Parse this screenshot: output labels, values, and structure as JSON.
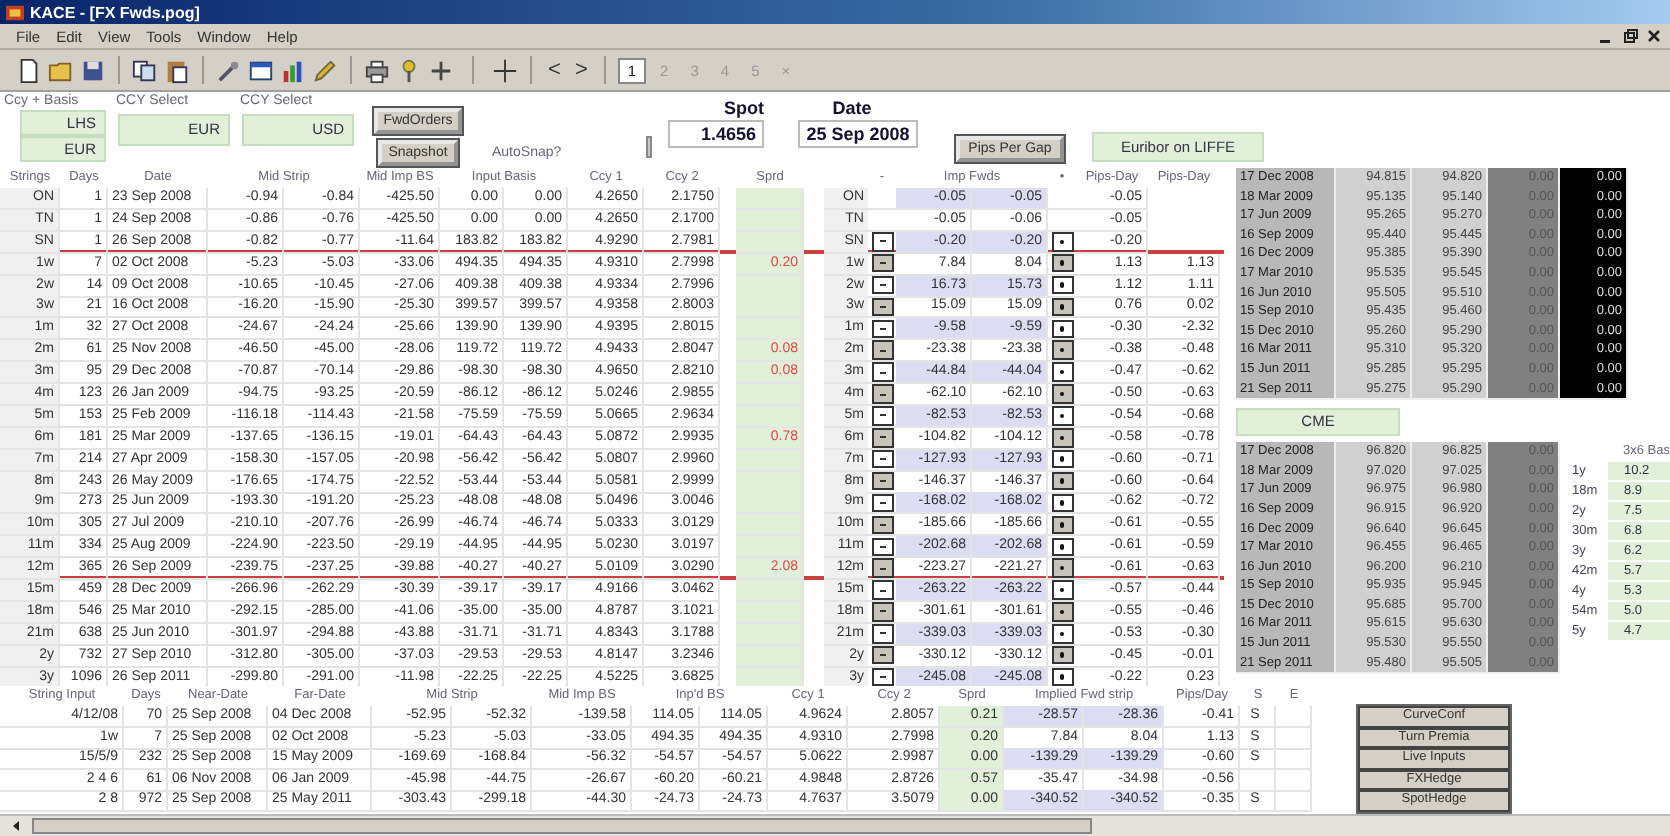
{
  "window": {
    "title": "KACE - [FX Fwds.pog]"
  },
  "menu": [
    "File",
    "Edit",
    "View",
    "Tools",
    "Window",
    "Help"
  ],
  "toolbar": {
    "nav": [
      "<",
      ">"
    ],
    "pages": [
      {
        "label": "1",
        "selected": true
      },
      {
        "label": "2",
        "selected": false
      },
      {
        "label": "3",
        "selected": false
      },
      {
        "label": "4",
        "selected": false
      },
      {
        "label": "5",
        "selected": false
      },
      {
        "label": "×",
        "selected": false
      }
    ]
  },
  "header": {
    "ccy_basis": {
      "label": "Ccy + Basis",
      "values": [
        "LHS",
        "EUR"
      ]
    },
    "ccy_selects": [
      {
        "label": "CCY Select",
        "value": "EUR"
      },
      {
        "label": "CCY Select",
        "value": "USD"
      }
    ],
    "buttons": [
      "FwdOrders",
      "Snapshot"
    ],
    "autosnap": {
      "label": "AutoSnap?",
      "checked": false
    },
    "spot": {
      "label": "Spot",
      "value": "1.4656"
    },
    "date": {
      "label": "Date",
      "value": "25 Sep 2008"
    },
    "pips_button": "Pips Per Gap",
    "source": "Euribor on LIFFE"
  },
  "main_table": {
    "columns": [
      "Strings",
      "Days",
      "Date",
      "Mid Strip",
      "Mid Imp BS",
      "Input Basis",
      "Ccy 1",
      "Ccy 2",
      "Sprd",
      "-",
      "Imp Fwds",
      "•",
      "Pips-Day",
      "Pips-Day"
    ],
    "rows": [
      {
        "tenor": "ON",
        "days": "1",
        "date": "23 Sep 2008",
        "mid_strip": [
          "-0.94",
          "-0.84"
        ],
        "mid_imp_bs": "-425.50",
        "input_basis": [
          "0.00",
          "0.00"
        ],
        "ccy1": "4.2650",
        "ccy2": "2.1750",
        "fwd_tenor": "ON",
        "controls": false,
        "imp_fwds": [
          "-0.05",
          "-0.05"
        ],
        "pips_day": [
          "-0.05"
        ],
        "rule_below": false
      },
      {
        "tenor": "TN",
        "days": "1",
        "date": "24 Sep 2008",
        "mid_strip": [
          "-0.86",
          "-0.76"
        ],
        "mid_imp_bs": "-425.50",
        "input_basis": [
          "0.00",
          "0.00"
        ],
        "ccy1": "4.2650",
        "ccy2": "2.1700",
        "fwd_tenor": "TN",
        "controls": false,
        "imp_fwds": [
          "-0.05",
          "-0.06"
        ],
        "pips_day": [
          "-0.05"
        ],
        "rule_below": false
      },
      {
        "tenor": "SN",
        "days": "1",
        "date": "26 Sep 2008",
        "mid_strip": [
          "-0.82",
          "-0.77"
        ],
        "mid_imp_bs": "-11.64",
        "input_basis": [
          "183.82",
          "183.82"
        ],
        "ccy1": "4.9290",
        "ccy2": "2.7981",
        "fwd_tenor": "SN",
        "controls": true,
        "imp_fwds": [
          "-0.20",
          "-0.20"
        ],
        "pips_day": [
          "-0.20"
        ],
        "rule_below": true
      },
      {
        "tenor": "1w",
        "days": "7",
        "date": "02 Oct 2008",
        "mid_strip": [
          "-5.23",
          "-5.03"
        ],
        "mid_imp_bs": "-33.06",
        "input_basis": [
          "494.35",
          "494.35"
        ],
        "ccy1": "4.9310",
        "ccy2": "2.7998",
        "sprd": "0.20",
        "fwd_tenor": "1w",
        "controls": true,
        "imp_fwds": [
          "7.84",
          "8.04"
        ],
        "pips_day": [
          "1.13",
          "1.13"
        ],
        "rule_below": false
      },
      {
        "tenor": "2w",
        "days": "14",
        "date": "09 Oct 2008",
        "mid_strip": [
          "-10.65",
          "-10.45"
        ],
        "mid_imp_bs": "-27.06",
        "input_basis": [
          "409.38",
          "409.38"
        ],
        "ccy1": "4.9334",
        "ccy2": "2.7996",
        "fwd_tenor": "2w",
        "controls": true,
        "imp_fwds": [
          "16.73",
          "15.73"
        ],
        "pips_day": [
          "1.12",
          "1.11"
        ],
        "rule_below": false
      },
      {
        "tenor": "3w",
        "days": "21",
        "date": "16 Oct 2008",
        "mid_strip": [
          "-16.20",
          "-15.90"
        ],
        "mid_imp_bs": "-25.30",
        "input_basis": [
          "399.57",
          "399.57"
        ],
        "ccy1": "4.9358",
        "ccy2": "2.8003",
        "fwd_tenor": "3w",
        "controls": true,
        "imp_fwds": [
          "15.09",
          "15.09"
        ],
        "pips_day": [
          "0.76",
          "0.02"
        ],
        "rule_below": false
      },
      {
        "tenor": "1m",
        "days": "32",
        "date": "27 Oct 2008",
        "mid_strip": [
          "-24.67",
          "-24.24"
        ],
        "mid_imp_bs": "-25.66",
        "input_basis": [
          "139.90",
          "139.90"
        ],
        "ccy1": "4.9395",
        "ccy2": "2.8015",
        "fwd_tenor": "1m",
        "controls": true,
        "imp_fwds": [
          "-9.58",
          "-9.59"
        ],
        "pips_day": [
          "-0.30",
          "-2.32"
        ],
        "rule_below": false
      },
      {
        "tenor": "2m",
        "days": "61",
        "date": "25 Nov 2008",
        "mid_strip": [
          "-46.50",
          "-45.00"
        ],
        "mid_imp_bs": "-28.06",
        "input_basis": [
          "119.72",
          "119.72"
        ],
        "ccy1": "4.9433",
        "ccy2": "2.8047",
        "sprd": "0.08",
        "fwd_tenor": "2m",
        "controls": true,
        "imp_fwds": [
          "-23.38",
          "-23.38"
        ],
        "pips_day": [
          "-0.38",
          "-0.48"
        ],
        "rule_below": false
      },
      {
        "tenor": "3m",
        "days": "95",
        "date": "29 Dec 2008",
        "mid_strip": [
          "-70.87",
          "-70.14"
        ],
        "mid_imp_bs": "-29.86",
        "input_basis": [
          "-98.30",
          "-98.30"
        ],
        "ccy1": "4.9650",
        "ccy2": "2.8210",
        "sprd": "0.08",
        "fwd_tenor": "3m",
        "controls": true,
        "imp_fwds": [
          "-44.84",
          "-44.04"
        ],
        "pips_day": [
          "-0.47",
          "-0.62"
        ],
        "rule_below": false
      },
      {
        "tenor": "4m",
        "days": "123",
        "date": "26 Jan 2009",
        "mid_strip": [
          "-94.75",
          "-93.25"
        ],
        "mid_imp_bs": "-20.59",
        "input_basis": [
          "-86.12",
          "-86.12"
        ],
        "ccy1": "5.0246",
        "ccy2": "2.9855",
        "fwd_tenor": "4m",
        "controls": true,
        "imp_fwds": [
          "-62.10",
          "-62.10"
        ],
        "pips_day": [
          "-0.50",
          "-0.63"
        ],
        "rule_below": false
      },
      {
        "tenor": "5m",
        "days": "153",
        "date": "25 Feb 2009",
        "mid_strip": [
          "-116.18",
          "-114.43"
        ],
        "mid_imp_bs": "-21.58",
        "input_basis": [
          "-75.59",
          "-75.59"
        ],
        "ccy1": "5.0665",
        "ccy2": "2.9634",
        "fwd_tenor": "5m",
        "controls": true,
        "imp_fwds": [
          "-82.53",
          "-82.53"
        ],
        "pips_day": [
          "-0.54",
          "-0.68"
        ],
        "rule_below": false
      },
      {
        "tenor": "6m",
        "days": "181",
        "date": "25 Mar 2009",
        "mid_strip": [
          "-137.65",
          "-136.15"
        ],
        "mid_imp_bs": "-19.01",
        "input_basis": [
          "-64.43",
          "-64.43"
        ],
        "ccy1": "5.0872",
        "ccy2": "2.9935",
        "sprd": "0.78",
        "fwd_tenor": "6m",
        "controls": true,
        "imp_fwds": [
          "-104.82",
          "-104.12"
        ],
        "pips_day": [
          "-0.58",
          "-0.78"
        ],
        "rule_below": false
      },
      {
        "tenor": "7m",
        "days": "214",
        "date": "27 Apr 2009",
        "mid_strip": [
          "-158.30",
          "-157.05"
        ],
        "mid_imp_bs": "-20.98",
        "input_basis": [
          "-56.42",
          "-56.42"
        ],
        "ccy1": "5.0807",
        "ccy2": "2.9960",
        "fwd_tenor": "7m",
        "controls": true,
        "imp_fwds": [
          "-127.93",
          "-127.93"
        ],
        "pips_day": [
          "-0.60",
          "-0.71"
        ],
        "rule_below": false
      },
      {
        "tenor": "8m",
        "days": "243",
        "date": "26 May 2009",
        "mid_strip": [
          "-176.65",
          "-174.75"
        ],
        "mid_imp_bs": "-22.52",
        "input_basis": [
          "-53.44",
          "-53.44"
        ],
        "ccy1": "5.0581",
        "ccy2": "2.9999",
        "fwd_tenor": "8m",
        "controls": true,
        "imp_fwds": [
          "-146.37",
          "-146.37"
        ],
        "pips_day": [
          "-0.60",
          "-0.64"
        ],
        "rule_below": false
      },
      {
        "tenor": "9m",
        "days": "273",
        "date": "25 Jun 2009",
        "mid_strip": [
          "-193.30",
          "-191.20"
        ],
        "mid_imp_bs": "-25.23",
        "input_basis": [
          "-48.08",
          "-48.08"
        ],
        "ccy1": "5.0496",
        "ccy2": "3.0046",
        "fwd_tenor": "9m",
        "controls": true,
        "imp_fwds": [
          "-168.02",
          "-168.02"
        ],
        "pips_day": [
          "-0.62",
          "-0.72"
        ],
        "rule_below": false
      },
      {
        "tenor": "10m",
        "days": "305",
        "date": "27 Jul 2009",
        "mid_strip": [
          "-210.10",
          "-207.76"
        ],
        "mid_imp_bs": "-26.99",
        "input_basis": [
          "-46.74",
          "-46.74"
        ],
        "ccy1": "5.0333",
        "ccy2": "3.0129",
        "fwd_tenor": "10m",
        "controls": true,
        "imp_fwds": [
          "-185.66",
          "-185.66"
        ],
        "pips_day": [
          "-0.61",
          "-0.55"
        ],
        "rule_below": false
      },
      {
        "tenor": "11m",
        "days": "334",
        "date": "25 Aug 2009",
        "mid_strip": [
          "-224.90",
          "-223.50"
        ],
        "mid_imp_bs": "-29.19",
        "input_basis": [
          "-44.95",
          "-44.95"
        ],
        "ccy1": "5.0230",
        "ccy2": "3.0197",
        "fwd_tenor": "11m",
        "controls": true,
        "imp_fwds": [
          "-202.68",
          "-202.68"
        ],
        "pips_day": [
          "-0.61",
          "-0.59"
        ],
        "rule_below": false
      },
      {
        "tenor": "12m",
        "days": "365",
        "date": "26 Sep 2009",
        "mid_strip": [
          "-239.75",
          "-237.25"
        ],
        "mid_imp_bs": "-39.88",
        "input_basis": [
          "-40.27",
          "-40.27"
        ],
        "ccy1": "5.0109",
        "ccy2": "3.0290",
        "sprd": "2.08",
        "fwd_tenor": "12m",
        "controls": true,
        "imp_fwds": [
          "-223.27",
          "-221.27"
        ],
        "pips_day": [
          "-0.61",
          "-0.63"
        ],
        "rule_below": true
      },
      {
        "tenor": "15m",
        "days": "459",
        "date": "28 Dec 2009",
        "mid_strip": [
          "-266.96",
          "-262.29"
        ],
        "mid_imp_bs": "-30.39",
        "input_basis": [
          "-39.17",
          "-39.17"
        ],
        "ccy1": "4.9166",
        "ccy2": "3.0462",
        "fwd_tenor": "15m",
        "controls": true,
        "imp_fwds": [
          "-263.22",
          "-263.22"
        ],
        "pips_day": [
          "-0.57",
          "-0.44"
        ],
        "rule_below": false
      },
      {
        "tenor": "18m",
        "days": "546",
        "date": "25 Mar 2010",
        "mid_strip": [
          "-292.15",
          "-285.00"
        ],
        "mid_imp_bs": "-41.06",
        "input_basis": [
          "-35.00",
          "-35.00"
        ],
        "ccy1": "4.8787",
        "ccy2": "3.1021",
        "fwd_tenor": "18m",
        "controls": true,
        "imp_fwds": [
          "-301.61",
          "-301.61"
        ],
        "pips_day": [
          "-0.55",
          "-0.46"
        ],
        "rule_below": false
      },
      {
        "tenor": "21m",
        "days": "638",
        "date": "25 Jun 2010",
        "mid_strip": [
          "-301.97",
          "-294.88"
        ],
        "mid_imp_bs": "-43.88",
        "input_basis": [
          "-31.71",
          "-31.71"
        ],
        "ccy1": "4.8343",
        "ccy2": "3.1788",
        "fwd_tenor": "21m",
        "controls": true,
        "imp_fwds": [
          "-339.03",
          "-339.03"
        ],
        "pips_day": [
          "-0.53",
          "-0.30"
        ],
        "rule_below": false
      },
      {
        "tenor": "2y",
        "days": "732",
        "date": "27 Sep 2010",
        "mid_strip": [
          "-312.80",
          "-305.00"
        ],
        "mid_imp_bs": "-37.03",
        "input_basis": [
          "-29.53",
          "-29.53"
        ],
        "ccy1": "4.8147",
        "ccy2": "3.2346",
        "fwd_tenor": "2y",
        "controls": true,
        "imp_fwds": [
          "-330.12",
          "-330.12"
        ],
        "pips_day": [
          "-0.45",
          "-0.01"
        ],
        "rule_below": false
      },
      {
        "tenor": "3y",
        "days": "1096",
        "date": "26 Sep 2011",
        "mid_strip": [
          "-299.80",
          "-291.00"
        ],
        "mid_imp_bs": "-11.98",
        "input_basis": [
          "-22.25",
          "-22.25"
        ],
        "ccy1": "4.5225",
        "ccy2": "3.6825",
        "fwd_tenor": "3y",
        "controls": true,
        "imp_fwds": [
          "-245.08",
          "-245.08"
        ],
        "pips_day": [
          "-0.22",
          "0.23"
        ],
        "rule_below": false
      }
    ]
  },
  "euribor": {
    "rows": [
      {
        "date": "17 Dec 2008",
        "bid": "94.815",
        "ask": "94.820",
        "change": "0.00",
        "value": "0.00"
      },
      {
        "date": "18 Mar 2009",
        "bid": "95.135",
        "ask": "95.140",
        "change": "0.00",
        "value": "0.00"
      },
      {
        "date": "17 Jun 2009",
        "bid": "95.265",
        "ask": "95.270",
        "change": "0.00",
        "value": "0.00"
      },
      {
        "date": "16 Sep 2009",
        "bid": "95.440",
        "ask": "95.445",
        "change": "0.00",
        "value": "0.00"
      },
      {
        "date": "16 Dec 2009",
        "bid": "95.385",
        "ask": "95.390",
        "change": "0.00",
        "value": "0.00"
      },
      {
        "date": "17 Mar 2010",
        "bid": "95.535",
        "ask": "95.545",
        "change": "0.00",
        "value": "0.00"
      },
      {
        "date": "16 Jun 2010",
        "bid": "95.505",
        "ask": "95.510",
        "change": "0.00",
        "value": "0.00"
      },
      {
        "date": "15 Sep 2010",
        "bid": "95.435",
        "ask": "95.460",
        "change": "0.00",
        "value": "0.00"
      },
      {
        "date": "15 Dec 2010",
        "bid": "95.260",
        "ask": "95.290",
        "change": "0.00",
        "value": "0.00"
      },
      {
        "date": "16 Mar 2011",
        "bid": "95.310",
        "ask": "95.320",
        "change": "0.00",
        "value": "0.00"
      },
      {
        "date": "15 Jun 2011",
        "bid": "95.285",
        "ask": "95.295",
        "change": "0.00",
        "value": "0.00"
      },
      {
        "date": "21 Sep 2011",
        "bid": "95.275",
        "ask": "95.290",
        "change": "0.00",
        "value": "0.00"
      }
    ]
  },
  "cme": {
    "label": "CME",
    "rows": [
      {
        "date": "17 Dec 2008",
        "bid": "96.820",
        "ask": "96.825",
        "change": "0.00"
      },
      {
        "date": "18 Mar 2009",
        "bid": "97.020",
        "ask": "97.025",
        "change": "0.00"
      },
      {
        "date": "17 Jun 2009",
        "bid": "96.975",
        "ask": "96.980",
        "change": "0.00"
      },
      {
        "date": "16 Sep 2009",
        "bid": "96.915",
        "ask": "96.920",
        "change": "0.00"
      },
      {
        "date": "16 Dec 2009",
        "bid": "96.640",
        "ask": "96.645",
        "change": "0.00"
      },
      {
        "date": "17 Mar 2010",
        "bid": "96.455",
        "ask": "96.465",
        "change": "0.00"
      },
      {
        "date": "16 Jun 2010",
        "bid": "96.200",
        "ask": "96.210",
        "change": "0.00"
      },
      {
        "date": "15 Sep 2010",
        "bid": "95.935",
        "ask": "95.945",
        "change": "0.00"
      },
      {
        "date": "15 Dec 2010",
        "bid": "95.685",
        "ask": "95.700",
        "change": "0.00"
      },
      {
        "date": "16 Mar 2011",
        "bid": "95.615",
        "ask": "95.630",
        "change": "0.00"
      },
      {
        "date": "15 Jun 2011",
        "bid": "95.530",
        "ask": "95.550",
        "change": "0.00"
      },
      {
        "date": "21 Sep 2011",
        "bid": "95.480",
        "ask": "95.505",
        "change": "0.00"
      }
    ]
  },
  "basis": {
    "title": "3x6 Bas",
    "rows": [
      {
        "tenor": "1y",
        "value": "10.2"
      },
      {
        "tenor": "18m",
        "value": "8.9"
      },
      {
        "tenor": "2y",
        "value": "7.5"
      },
      {
        "tenor": "30m",
        "value": "6.8"
      },
      {
        "tenor": "3y",
        "value": "6.2"
      },
      {
        "tenor": "42m",
        "value": "5.7"
      },
      {
        "tenor": "4y",
        "value": "5.3"
      },
      {
        "tenor": "54m",
        "value": "5.0"
      },
      {
        "tenor": "5y",
        "value": "4.7"
      }
    ]
  },
  "strip_table": {
    "columns": [
      "String Input",
      "Days",
      "Near-Date",
      "Far-Date",
      "Mid Strip",
      "Mid Imp BS",
      "Inp'd BS",
      "Ccy 1",
      "Ccy 2",
      "Sprd",
      "Implied Fwd strip",
      "Pips/Day",
      "S",
      "E"
    ],
    "rows": [
      {
        "input": "4/12/08",
        "days": "70",
        "near": "25 Sep 2008",
        "far": "04 Dec 2008",
        "mid_strip": [
          "-52.95",
          "-52.32"
        ],
        "mid_imp_bs": "-139.58",
        "inpd_bs": [
          "114.05",
          "114.05"
        ],
        "ccy1": "4.9624",
        "ccy2": "2.8057",
        "sprd": "0.21",
        "implied": [
          "-28.57",
          "-28.36"
        ],
        "pips_day": "-0.41",
        "s": "S"
      },
      {
        "input": "1w",
        "days": "7",
        "near": "25 Sep 2008",
        "far": "02 Oct 2008",
        "mid_strip": [
          "-5.23",
          "-5.03"
        ],
        "mid_imp_bs": "-33.05",
        "inpd_bs": [
          "494.35",
          "494.35"
        ],
        "ccy1": "4.9310",
        "ccy2": "2.7998",
        "sprd": "0.20",
        "implied": [
          "7.84",
          "8.04"
        ],
        "pips_day": "1.13",
        "s": "S"
      },
      {
        "input": "15/5/9",
        "days": "232",
        "near": "25 Sep 2008",
        "far": "15 May 2009",
        "mid_strip": [
          "-169.69",
          "-168.84"
        ],
        "mid_imp_bs": "-56.32",
        "inpd_bs": [
          "-54.57",
          "-54.57"
        ],
        "ccy1": "5.0622",
        "ccy2": "2.9987",
        "sprd": "0.00",
        "implied": [
          "-139.29",
          "-139.29"
        ],
        "pips_day": "-0.60",
        "s": "S"
      },
      {
        "input": "2 4 6",
        "days": "61",
        "near": "06 Nov 2008",
        "far": "06 Jan 2009",
        "mid_strip": [
          "-45.98",
          "-44.75"
        ],
        "mid_imp_bs": "-26.67",
        "inpd_bs": [
          "-60.20",
          "-60.21"
        ],
        "ccy1": "4.9848",
        "ccy2": "2.8726",
        "sprd": "0.57",
        "implied": [
          "-35.47",
          "-34.98"
        ],
        "pips_day": "-0.56"
      },
      {
        "input": "2 8",
        "days": "972",
        "near": "25 Sep 2008",
        "far": "25 May 2011",
        "mid_strip": [
          "-303.43",
          "-299.18"
        ],
        "mid_imp_bs": "-44.30",
        "inpd_bs": [
          "-24.73",
          "-24.73"
        ],
        "ccy1": "4.7637",
        "ccy2": "3.5079",
        "sprd": "0.00",
        "implied": [
          "-340.52",
          "-340.52"
        ],
        "pips_day": "-0.35",
        "s": "S"
      }
    ]
  },
  "side_buttons": [
    "CurveConf",
    "Turn Premia",
    "Live Inputs",
    "FXHedge",
    "SpotHedge"
  ]
}
